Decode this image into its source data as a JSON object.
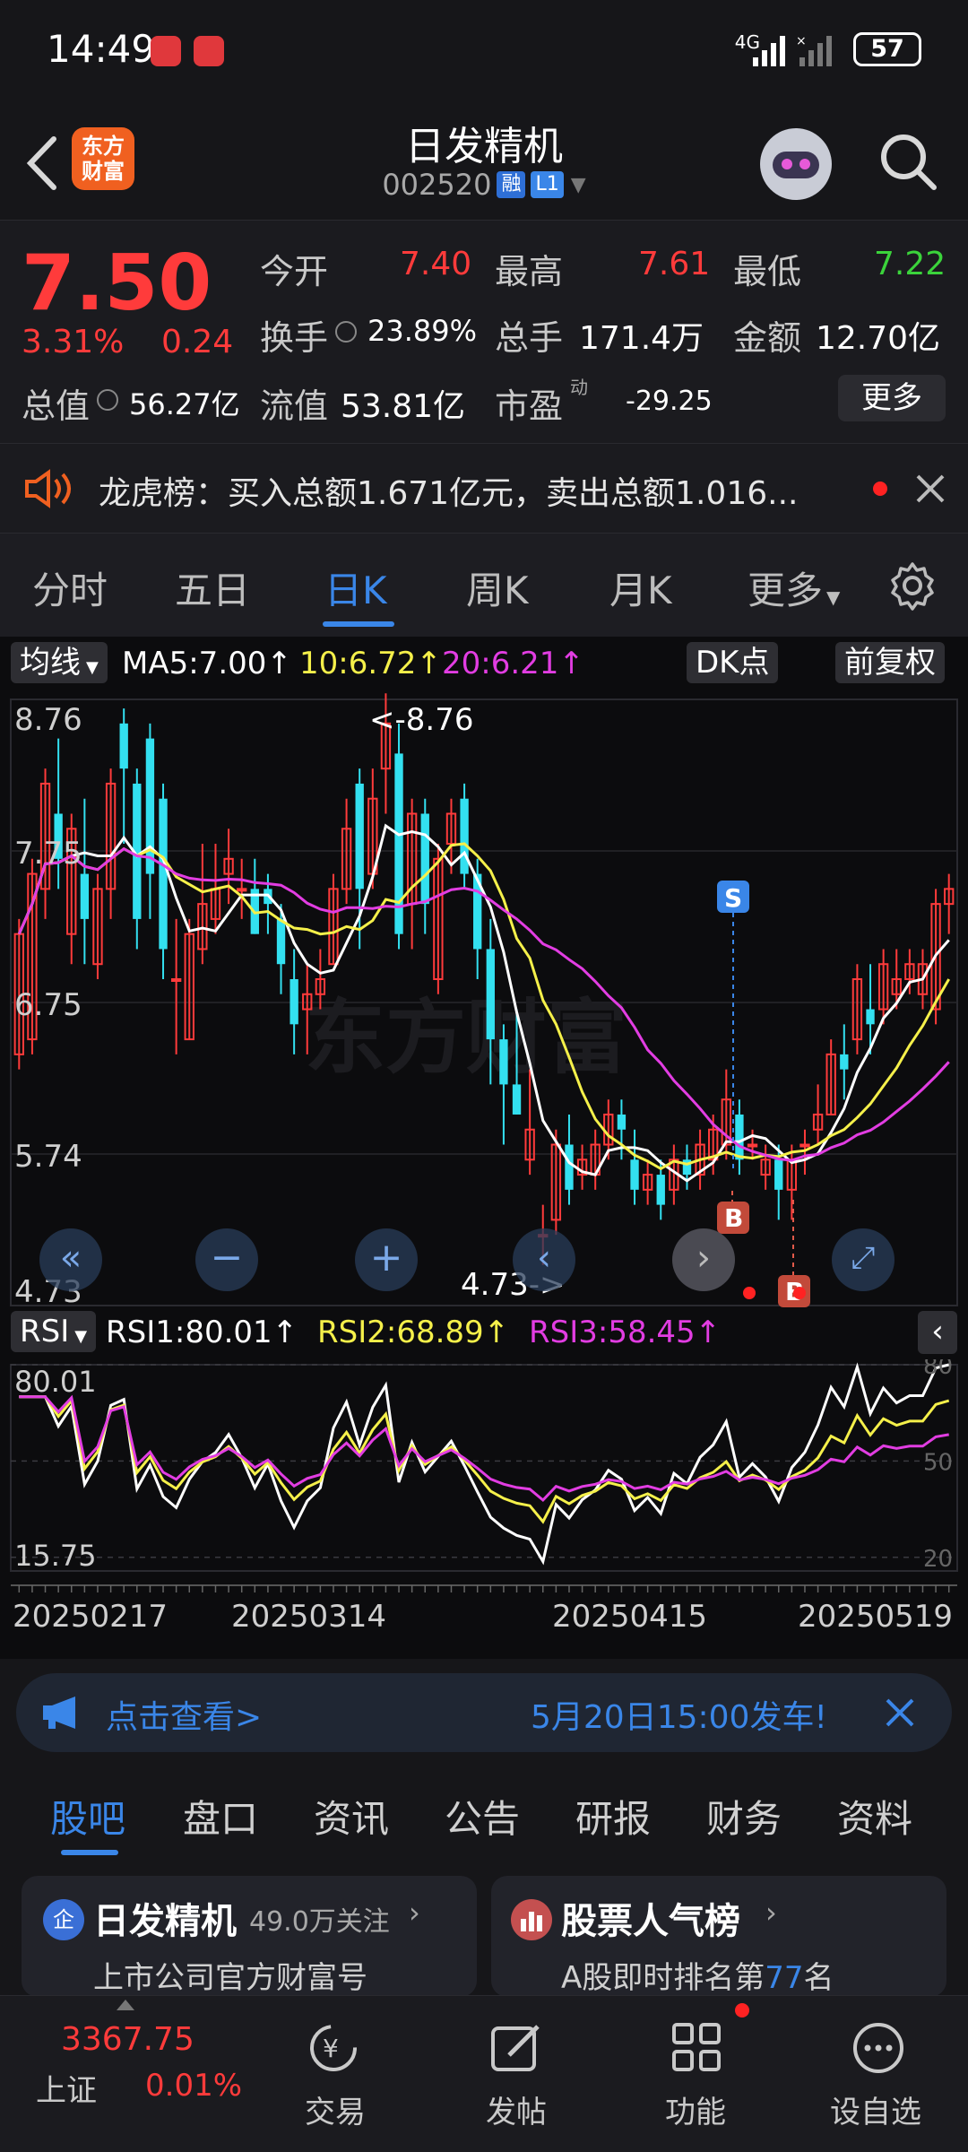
{
  "status": {
    "time": "14:49",
    "network": "4G",
    "battery": "57"
  },
  "header": {
    "name": "日发精机",
    "code": "002520",
    "tag_margin": "融",
    "tag_level": "L1",
    "logo": "东方\n财富"
  },
  "quote": {
    "price": "7.50",
    "pct": "3.31%",
    "chg": "0.24",
    "open_label": "今开",
    "open": "7.40",
    "high_label": "最高",
    "high": "7.61",
    "low_label": "最低",
    "low": "7.22",
    "turnover_label": "换手",
    "turnover": "23.89%",
    "volume_label": "总手",
    "volume": "171.4万",
    "amount_label": "金额",
    "amount": "12.70亿",
    "mcap_label": "总值",
    "mcap": "56.27亿",
    "float_label": "流值",
    "float": "53.81亿",
    "pe_label": "市盈",
    "pe_sup": "动",
    "pe": "-29.25",
    "more": "更多"
  },
  "notice": {
    "text": "龙虎榜：买入总额1.671亿元，卖出总额1.016..."
  },
  "period_tabs": [
    "分时",
    "五日",
    "日K",
    "周K",
    "月K",
    "更多"
  ],
  "active_tab": "日K",
  "ma": {
    "selector": "均线",
    "ma5": "MA5:7.00",
    "ma10": "10:6.72",
    "ma20": "20:6.21",
    "dk": "DK点",
    "adjust": "前复权"
  },
  "price_axis": [
    "8.76",
    "7.75",
    "6.75",
    "5.74",
    "4.73"
  ],
  "annotations": {
    "high": "<-8.76",
    "low": "4.73->",
    "sell": "S",
    "buy": "B"
  },
  "rsi": {
    "selector": "RSI",
    "rsi1": "RSI1:80.01",
    "rsi2": "RSI2:68.89",
    "rsi3": "RSI3:58.45",
    "axis_top": "80.01",
    "axis_bottom": "15.75",
    "level_80": "80",
    "level_50": "50",
    "level_20": "20"
  },
  "dates": [
    "20250217",
    "20250314",
    "20250415",
    "20250519"
  ],
  "banner": {
    "left": "点击查看>",
    "right": "5月20日15:00发车!"
  },
  "news_tabs": [
    "股吧",
    "盘口",
    "资讯",
    "公告",
    "研报",
    "财务",
    "资料"
  ],
  "cards": [
    {
      "title": "日发精机",
      "meta": "49.0万关注",
      "sub": "上市公司官方财富号",
      "badge": "企"
    },
    {
      "title": "股票人气榜",
      "sub_prefix": "A股即时排名第",
      "rank": "77",
      "sub_suffix": "名"
    }
  ],
  "bottom_nav": {
    "index_value": "3367.75",
    "index_name": "上证",
    "index_pct": "0.01%",
    "trade": "交易",
    "post": "发帖",
    "func": "功能",
    "watch": "设自选"
  },
  "colors": {
    "up": "#ff3b3b",
    "down": "#33e0f0",
    "ma5": "#ffffff",
    "ma10": "#f5f04a",
    "ma20": "#e23de2",
    "accent": "#3a86e8"
  },
  "chart_data": {
    "type": "candlestick",
    "y_range": [
      4.73,
      8.76
    ],
    "candles": [
      [
        6.4,
        7.2,
        6.3,
        7.3
      ],
      [
        6.5,
        7.6,
        6.4,
        7.7
      ],
      [
        7.5,
        8.2,
        7.3,
        8.3
      ],
      [
        8.0,
        7.7,
        7.5,
        8.5
      ],
      [
        7.2,
        7.9,
        7.0,
        8.0
      ],
      [
        7.6,
        7.3,
        7.0,
        8.1
      ],
      [
        7.0,
        7.5,
        6.9,
        7.6
      ],
      [
        7.5,
        8.2,
        7.3,
        8.3
      ],
      [
        8.6,
        8.3,
        7.8,
        8.7
      ],
      [
        8.2,
        7.3,
        7.1,
        8.3
      ],
      [
        8.5,
        7.6,
        7.3,
        8.6
      ],
      [
        8.1,
        7.1,
        6.9,
        8.2
      ],
      [
        6.9,
        6.9,
        6.4,
        7.3
      ],
      [
        6.5,
        7.2,
        6.5,
        7.3
      ],
      [
        7.1,
        7.4,
        7.0,
        7.8
      ],
      [
        7.3,
        7.5,
        7.2,
        7.8
      ],
      [
        7.6,
        7.7,
        7.4,
        7.9
      ],
      [
        7.5,
        7.5,
        7.3,
        7.7
      ],
      [
        7.5,
        7.2,
        7.2,
        7.7
      ],
      [
        7.5,
        7.4,
        7.2,
        7.6
      ],
      [
        7.3,
        7.0,
        6.8,
        7.4
      ],
      [
        6.9,
        6.6,
        6.4,
        7.1
      ],
      [
        6.7,
        6.8,
        6.4,
        7.0
      ],
      [
        6.8,
        6.9,
        6.7,
        7.1
      ],
      [
        7.0,
        7.5,
        7.0,
        7.6
      ],
      [
        7.5,
        7.9,
        7.4,
        8.1
      ],
      [
        8.2,
        7.5,
        7.1,
        8.3
      ],
      [
        7.6,
        8.1,
        7.5,
        8.3
      ],
      [
        8.3,
        8.6,
        8.0,
        8.8
      ],
      [
        8.4,
        7.2,
        7.1,
        8.6
      ],
      [
        7.4,
        8.0,
        7.1,
        8.1
      ],
      [
        8.0,
        7.4,
        7.2,
        8.1
      ],
      [
        6.9,
        7.7,
        6.8,
        7.8
      ],
      [
        7.8,
        8.0,
        7.6,
        8.1
      ],
      [
        8.1,
        7.6,
        7.5,
        8.2
      ],
      [
        7.6,
        7.1,
        6.9,
        7.7
      ],
      [
        7.1,
        6.5,
        6.2,
        7.3
      ],
      [
        6.5,
        6.2,
        5.8,
        6.6
      ],
      [
        6.2,
        6.0,
        6.0,
        6.7
      ],
      [
        5.7,
        5.9,
        5.6,
        6.3
      ],
      [
        5.2,
        5.2,
        5.0,
        5.4
      ],
      [
        5.3,
        5.8,
        5.2,
        5.9
      ],
      [
        5.8,
        5.5,
        5.4,
        6.0
      ],
      [
        5.6,
        5.7,
        5.5,
        5.8
      ],
      [
        5.6,
        5.8,
        5.5,
        5.9
      ],
      [
        5.8,
        6.0,
        5.7,
        6.1
      ],
      [
        6.0,
        5.9,
        5.7,
        6.1
      ],
      [
        5.7,
        5.5,
        5.4,
        5.9
      ],
      [
        5.5,
        5.6,
        5.4,
        5.7
      ],
      [
        5.6,
        5.4,
        5.3,
        5.7
      ],
      [
        5.5,
        5.7,
        5.4,
        5.8
      ],
      [
        5.7,
        5.6,
        5.5,
        5.8
      ],
      [
        5.6,
        5.8,
        5.5,
        5.9
      ],
      [
        5.7,
        5.9,
        5.6,
        6.0
      ],
      [
        5.8,
        6.1,
        5.7,
        6.3
      ],
      [
        6.0,
        5.7,
        5.6,
        6.1
      ],
      [
        5.8,
        5.8,
        5.7,
        5.9
      ],
      [
        5.6,
        5.7,
        5.5,
        5.8
      ],
      [
        5.7,
        5.5,
        5.3,
        5.8
      ],
      [
        5.5,
        5.7,
        5.3,
        5.8
      ],
      [
        5.8,
        5.8,
        5.6,
        5.9
      ],
      [
        5.9,
        6.0,
        5.8,
        6.2
      ],
      [
        6.0,
        6.4,
        6.0,
        6.5
      ],
      [
        6.4,
        6.3,
        6.1,
        6.6
      ],
      [
        6.5,
        6.9,
        6.4,
        7.0
      ],
      [
        6.7,
        6.6,
        6.4,
        7.0
      ],
      [
        6.7,
        7.0,
        6.6,
        7.1
      ],
      [
        6.8,
        6.9,
        6.7,
        7.1
      ],
      [
        6.9,
        7.0,
        6.8,
        7.1
      ],
      [
        6.8,
        7.0,
        6.7,
        7.1
      ],
      [
        6.7,
        7.4,
        6.6,
        7.5
      ],
      [
        7.4,
        7.5,
        7.2,
        7.6
      ]
    ],
    "rsi_range": [
      15.75,
      80.01
    ]
  }
}
